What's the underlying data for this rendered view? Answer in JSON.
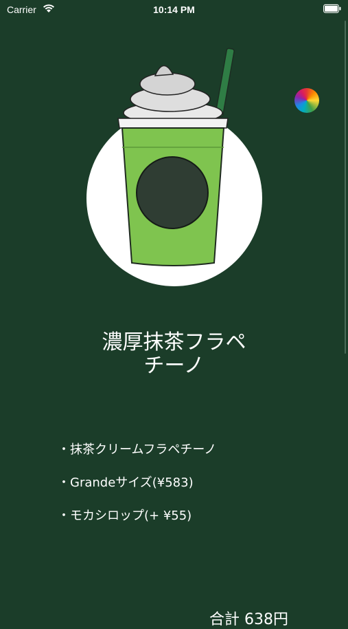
{
  "status_bar": {
    "carrier": "Carrier",
    "time": "10:14 PM"
  },
  "product": {
    "name_line1": "濃厚抹茶フラペ",
    "name_line2": "チーノ",
    "image_icon": "matcha-frappuccino-illustration"
  },
  "options": [
    {
      "label": "・抹茶クリームフラペチーノ"
    },
    {
      "label": "・Grandeサイズ(¥583)"
    },
    {
      "label": "・モカシロップ(+ ¥55)"
    }
  ],
  "total": {
    "label": "合計 638円"
  },
  "colors": {
    "background": "#1b3d29",
    "matcha": "#7fc44f",
    "text": "#ffffff"
  }
}
